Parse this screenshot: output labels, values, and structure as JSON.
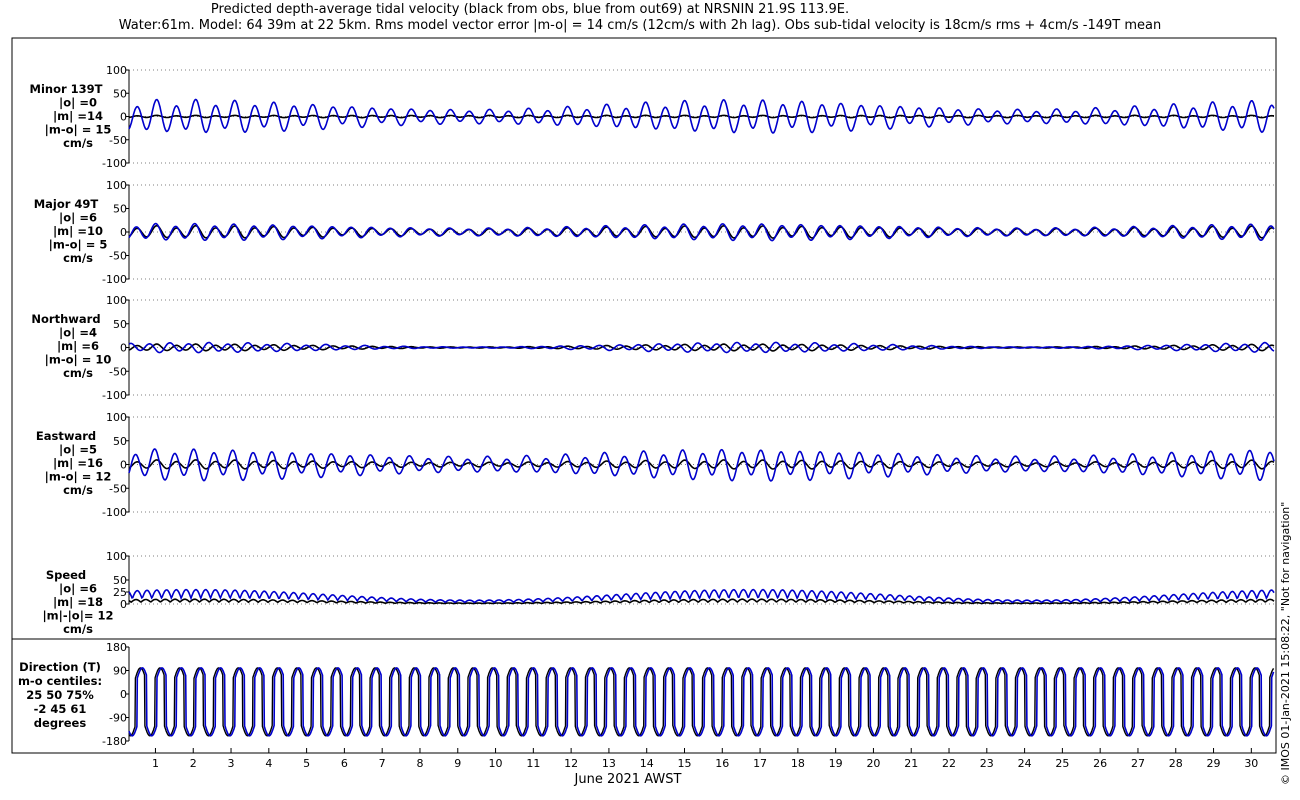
{
  "title_line1": "Predicted depth-average tidal velocity (black from obs, blue from out69) at NRSNIN 21.9S 113.9E.",
  "title_line2": "Water:61m. Model: 64 39m at 22 5km. Rms model vector error |m-o| = 14 cm/s (12cm/s with 2h lag). Obs sub-tidal velocity is 18cm/s rms + 4cm/s -149T mean",
  "copyright": "© IMOS 01-Jan-2021 15:08:22, \"Not for navigation\"",
  "colors": {
    "obs": "#000000",
    "model": "#0000cc",
    "axis": "#000000"
  },
  "chart_data": {
    "type": "line",
    "xlabel": "June 2021 AWST",
    "x_ticks": [
      "1",
      "2",
      "3",
      "4",
      "5",
      "6",
      "7",
      "8",
      "9",
      "10",
      "11",
      "12",
      "13",
      "14",
      "15",
      "16",
      "17",
      "18",
      "19",
      "20",
      "21",
      "22",
      "23",
      "24",
      "25",
      "26",
      "27",
      "28",
      "29",
      "30"
    ],
    "xlim": [
      0.3,
      30.6
    ],
    "panels": [
      {
        "key": "minor",
        "label_lines": [
          "Minor 139T",
          "|o| =0",
          "|m| =14",
          "|m-o| = 15",
          "cm/s"
        ],
        "ylim": [
          -100,
          100
        ],
        "yticks": [
          100,
          50,
          0,
          -50,
          -100
        ],
        "yticklabels": [
          "100",
          "50",
          "0",
          "-50",
          "-100"
        ],
        "obs_amp": 2,
        "model_amp": [
          13,
          30
        ],
        "model_phase": 0.0
      },
      {
        "key": "major",
        "label_lines": [
          "Major 49T",
          "|o| =6",
          "|m| =10",
          "|m-o| = 5",
          "cm/s"
        ],
        "ylim": [
          -100,
          100
        ],
        "yticks": [
          100,
          50,
          0,
          -50,
          -100
        ],
        "yticklabels": [
          "100",
          "50",
          "0",
          "-50",
          "-100"
        ],
        "obs_amp": [
          6,
          11
        ],
        "model_amp": [
          7,
          15
        ],
        "model_phase": 0.3
      },
      {
        "key": "north",
        "label_lines": [
          "Northward",
          "|o| =4",
          "|m| =6",
          "|m-o| = 10",
          "cm/s"
        ],
        "ylim": [
          -100,
          100
        ],
        "yticks": [
          100,
          50,
          0,
          -50,
          -100
        ],
        "yticklabels": [
          "100",
          "50",
          "0",
          "-50",
          "-100"
        ],
        "obs_amp": [
          1,
          6
        ],
        "model_amp": [
          1,
          9
        ],
        "model_phase": 2.2
      },
      {
        "key": "east",
        "label_lines": [
          "Eastward",
          "|o| =5",
          "|m| =16",
          "|m-o| = 12",
          "cm/s"
        ],
        "ylim": [
          -100,
          100
        ],
        "yticks": [
          100,
          50,
          0,
          -50,
          -100
        ],
        "yticklabels": [
          "100",
          "50",
          "0",
          "-50",
          "-100"
        ],
        "obs_amp": [
          4,
          8
        ],
        "model_amp": [
          14,
          28
        ],
        "model_phase": 0.6
      },
      {
        "key": "speed",
        "label_lines": [
          "Speed",
          "|o| =6",
          "|m| =18",
          "|m|-|o|= 12",
          "cm/s"
        ],
        "ylim": [
          0,
          100
        ],
        "yticks": [
          100,
          50,
          25,
          0
        ],
        "yticklabels": [
          "100",
          "50",
          "25",
          "0"
        ],
        "speed": true,
        "obs_amp": [
          2,
          10
        ],
        "model_amp": [
          8,
          30
        ]
      }
    ],
    "direction_panel": {
      "label_lines": [
        "Direction (T)",
        "m-o centiles:",
        "25  50  75%",
        "-2  45  61",
        "degrees"
      ],
      "ylim": [
        -180,
        180
      ],
      "yticks": [
        180,
        90,
        0,
        -90,
        -180
      ],
      "yticklabels": [
        "180",
        "90",
        "0",
        "-90",
        "-180"
      ]
    }
  }
}
